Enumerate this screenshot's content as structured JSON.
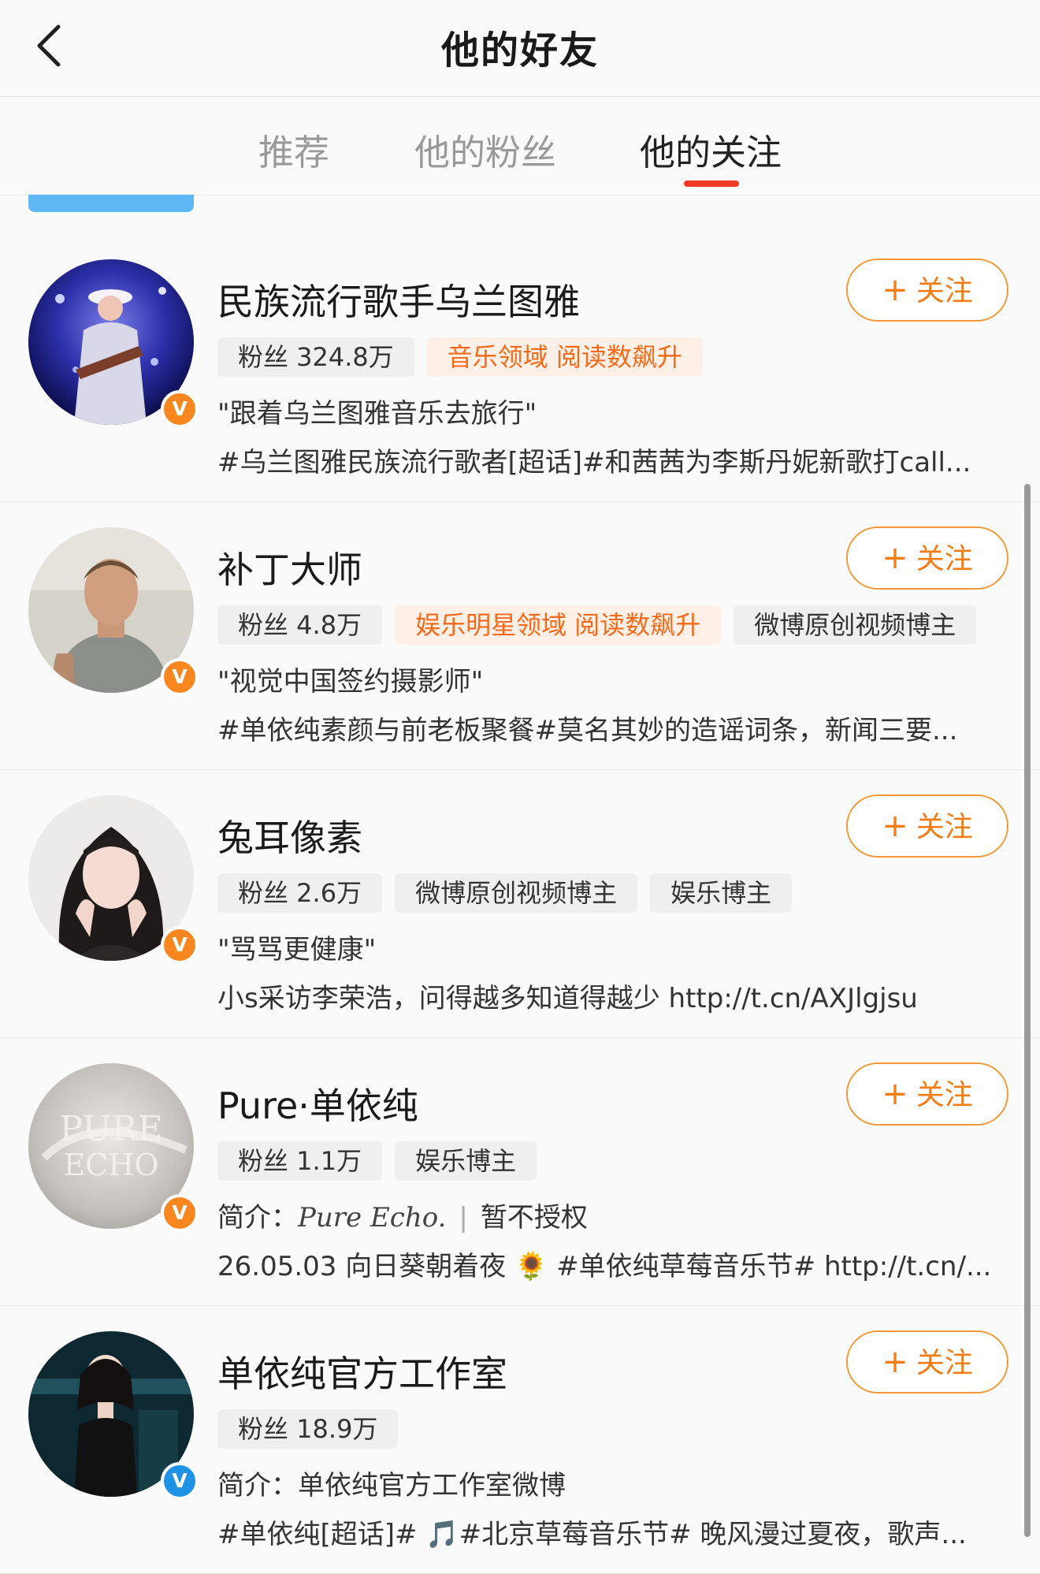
{
  "header": {
    "title": "他的好友"
  },
  "tabs": [
    {
      "label": "推荐",
      "active": false
    },
    {
      "label": "他的粉丝",
      "active": false
    },
    {
      "label": "他的关注",
      "active": true
    }
  ],
  "follow_label": "关注",
  "colors": {
    "accent": "#f23a26",
    "follow": "#f07d15",
    "hot_tag_bg": "#fff0e7"
  },
  "users": [
    {
      "name": "民族流行歌手乌兰图雅",
      "fans": "粉丝 324.8万",
      "tags": [
        {
          "text": "音乐领域 阅读数飙升",
          "hot": true
        }
      ],
      "line1": "\"跟着乌兰图雅音乐去旅行\"",
      "line2": "#乌兰图雅民族流行歌者[超话]#和茜茜为李斯丹妮新歌打call...",
      "badge": "orange"
    },
    {
      "name": "补丁大师",
      "fans": "粉丝 4.8万",
      "tags": [
        {
          "text": "娱乐明星领域 阅读数飙升",
          "hot": true
        },
        {
          "text": "微博原创视频博主",
          "hot": false
        }
      ],
      "line1": "\"视觉中国签约摄影师\"",
      "line2": "#单依纯素颜与前老板聚餐#莫名其妙的造谣词条，新闻三要...",
      "badge": "orange"
    },
    {
      "name": "兔耳像素",
      "fans": "粉丝 2.6万",
      "tags": [
        {
          "text": "微博原创视频博主",
          "hot": false
        },
        {
          "text": "娱乐博主",
          "hot": false
        }
      ],
      "line1": "\"骂骂更健康\"",
      "line2": "小s采访李荣浩，问得越多知道得越少 http://t.cn/AXJlgjsu",
      "badge": "orange"
    },
    {
      "name": "Pure·单依纯",
      "fans": "粉丝 1.1万",
      "tags": [
        {
          "text": "娱乐博主",
          "hot": false
        }
      ],
      "line1_prefix": "简介：",
      "line1_italic": "Pure Echo.",
      "line1_suffix": "暂不授权",
      "line2": "26.05.03 向日葵朝着夜 🌻 #单依纯草莓音乐节# http://t.cn/...",
      "badge": "orange"
    },
    {
      "name": "单依纯官方工作室",
      "fans": "粉丝 18.9万",
      "tags": [],
      "line1": "简介：单依纯官方工作室微博",
      "line2": "#单依纯[超话]# 🎵#北京草莓音乐节# 晚风漫过夏夜，歌声...",
      "badge": "blue"
    }
  ]
}
